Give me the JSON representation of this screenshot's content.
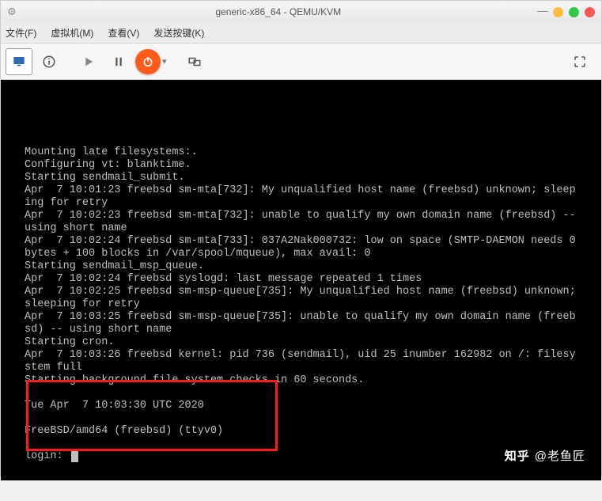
{
  "titlebar": {
    "title": "generic-x86_64 - QEMU/KVM"
  },
  "menubar": {
    "file": "文件(F)",
    "vm": "虚拟机(M)",
    "view": "查看(V)",
    "sendkeys": "发送按键(K)"
  },
  "terminal": {
    "lines": [
      "Mounting late filesystems:.",
      "Configuring vt: blanktime.",
      "Starting sendmail_submit.",
      "Apr  7 10:01:23 freebsd sm-mta[732]: My unqualified host name (freebsd) unknown; sleeping for retry",
      "Apr  7 10:02:23 freebsd sm-mta[732]: unable to qualify my own domain name (freebsd) -- using short name",
      "Apr  7 10:02:24 freebsd sm-mta[733]: 037A2Nak000732: low on space (SMTP-DAEMON needs 0 bytes + 100 blocks in /var/spool/mqueue), max avail: 0",
      "Starting sendmail_msp_queue.",
      "Apr  7 10:02:24 freebsd syslogd: last message repeated 1 times",
      "Apr  7 10:02:25 freebsd sm-msp-queue[735]: My unqualified host name (freebsd) unknown; sleeping for retry",
      "Apr  7 10:03:25 freebsd sm-msp-queue[735]: unable to qualify my own domain name (freebsd) -- using short name",
      "Starting cron.",
      "Apr  7 10:03:26 freebsd kernel: pid 736 (sendmail), uid 25 inumber 162982 on /: filesystem full",
      "Starting background file system checks in 60 seconds.",
      "",
      "Tue Apr  7 10:03:30 UTC 2020",
      "",
      "FreeBSD/amd64 (freebsd) (ttyv0)",
      "",
      "login: "
    ]
  },
  "watermark": {
    "brand": "知乎",
    "author": "@老鱼匠"
  }
}
